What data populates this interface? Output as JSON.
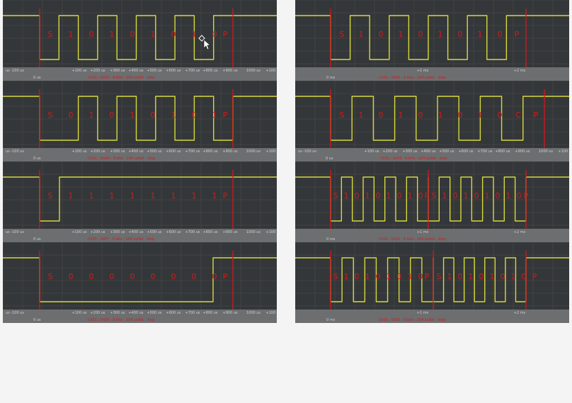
{
  "colors": {
    "scope_bg": "#343739",
    "signal": "#d8d83a",
    "marker": "#d4161c",
    "decode_text": "#d21b1b",
    "axis_bar": "#6c6e70",
    "tick_text": "#cfcfcf",
    "page_bg": "#f4f4f4"
  },
  "panels": [
    {
      "id": "l1",
      "bits": [
        "S",
        "1",
        "0",
        "1",
        "0",
        "1",
        "0",
        "1",
        "0",
        "P"
      ],
      "ticks": [
        "us  -100 us",
        "+100 us",
        "+200 us",
        "+300 us",
        "+400 us",
        "+500 us",
        "+600 us",
        "+700 us",
        "+800 us",
        "+900 us",
        "1000 us",
        "+100 us",
        "+200 us",
        "+300 us",
        "+400 us"
      ],
      "zero_label": "0 us",
      "decode_line": "Ch01 : 0x55 · 9 bits · 104 us/bit · stop"
    },
    {
      "id": "r1",
      "bits": [
        "S",
        "1",
        "0",
        "1",
        "0",
        "1",
        "0",
        "1",
        "0",
        "P"
      ],
      "ticks": [
        "+1 ms",
        "+2 ms"
      ],
      "zero_label": "0 ms",
      "decode_line": "Ch01 : 0x55 · 9 bits · 104 us/bit · stop"
    },
    {
      "id": "l2",
      "bits": [
        "S",
        "0",
        "1",
        "0",
        "1",
        "0",
        "1",
        "0",
        "1",
        "P"
      ],
      "ticks": [
        "us  -100 us",
        "+100 us",
        "+200 us",
        "+300 us",
        "+400 us",
        "+500 us",
        "+600 us",
        "+700 us",
        "+800 us",
        "+900 us",
        "1000 us",
        "+100 us",
        "+200 us",
        "+300 us",
        "+400 us"
      ],
      "zero_label": "0 us",
      "decode_line": "Ch01 : 0xAA · 9 bits · 104 us/bit · stop"
    },
    {
      "id": "r2",
      "bits": [
        "S",
        "1",
        "0",
        "1",
        "0",
        "1",
        "0",
        "1",
        "0",
        "C",
        "P"
      ],
      "ticks": [
        "us  -100 us",
        "+100 us",
        "+200 us",
        "+300 us",
        "+400 us",
        "+500 us",
        "+600 us",
        "+700 us",
        "+800 us",
        "+900 us",
        "1000 us",
        "+100 us",
        "+200 us",
        "+300 us",
        "+400 us"
      ],
      "zero_label": "0 us",
      "decode_line": "Ch01 : 0x55 · 9 bits · 104 us/bit · stop"
    },
    {
      "id": "l3",
      "bits": [
        "S",
        "1",
        "1",
        "1",
        "1",
        "1",
        "1",
        "1",
        "1",
        "P"
      ],
      "ticks": [
        "us  -100 us",
        "+100 us",
        "+200 us",
        "+300 us",
        "+400 us",
        "+500 us",
        "+600 us",
        "+700 us",
        "+800 us",
        "+900 us",
        "1000 us",
        "+100 us",
        "+200 us",
        "+300 us",
        "+400 us"
      ],
      "zero_label": "0 us",
      "decode_line": "Ch01 : 0xFF · 9 bits · 104 us/bit · stop"
    },
    {
      "id": "r3",
      "bits": [
        "S",
        "1",
        "0",
        "1",
        "0",
        "1",
        "0",
        "1",
        "0",
        "P",
        "S",
        "1",
        "0",
        "1",
        "0",
        "1",
        "0",
        "1",
        "0",
        "P"
      ],
      "ticks": [
        "+1 ms",
        "+2 ms"
      ],
      "zero_label": "0 ms",
      "decode_line": "Ch01 : 0x55 · 9 bits · 104 us/bit · stop"
    },
    {
      "id": "l4",
      "bits": [
        "S",
        "0",
        "0",
        "0",
        "0",
        "0",
        "0",
        "0",
        "0",
        "P"
      ],
      "ticks": [
        "us  -100 us",
        "+100 us",
        "+200 us",
        "+300 us",
        "+400 us",
        "+500 us",
        "+600 us",
        "+700 us",
        "+800 us",
        "+900 us",
        "1000 us",
        "+100 us",
        "+200 us",
        "+300 us",
        "+400 us"
      ],
      "zero_label": "0 us",
      "decode_line": "Ch01 : 0x00 · 9 bits · 104 us/bit · stop"
    },
    {
      "id": "r4",
      "bits": [
        "S",
        "1",
        "0",
        "1",
        "0",
        "1",
        "0",
        "1",
        "0",
        "P",
        "S",
        "1",
        "0",
        "1",
        "0",
        "1",
        "0",
        "1",
        "0",
        "P"
      ],
      "ticks": [
        "+1 ms",
        "+2 ms"
      ],
      "zero_label": "0 ms",
      "decode_line": "Ch01 : 0x55 · 9 bits · 104 us/bit · stop"
    }
  ]
}
